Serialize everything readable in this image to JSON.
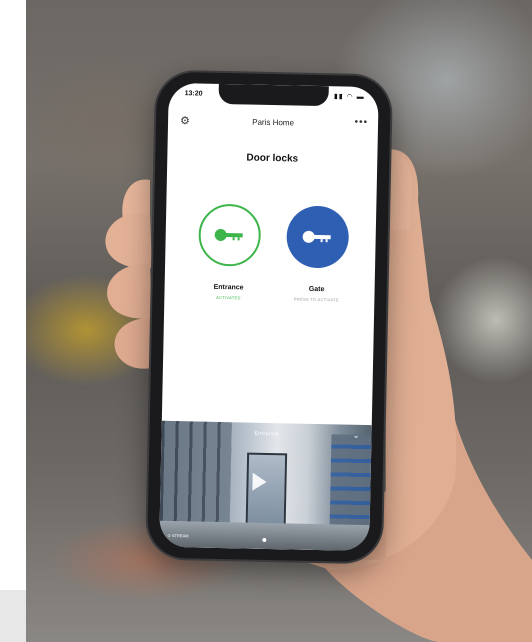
{
  "status_bar": {
    "time": "13:20",
    "icons": "▮▮ ◠ ▬"
  },
  "header": {
    "title": "Paris Home",
    "more": "•••"
  },
  "section": {
    "title": "Door locks"
  },
  "locks": [
    {
      "name": "Entrance",
      "status": "ACTIVATED"
    },
    {
      "name": "Gate",
      "status": "PRESS TO ACTIVATE"
    }
  ],
  "camera": {
    "label": "Entrance",
    "chevron": "⌄",
    "footer": "⊙ STREAM"
  },
  "colors": {
    "active": "#3db54a",
    "gate": "#2f5fb3",
    "phone": "#1a1a1c"
  }
}
